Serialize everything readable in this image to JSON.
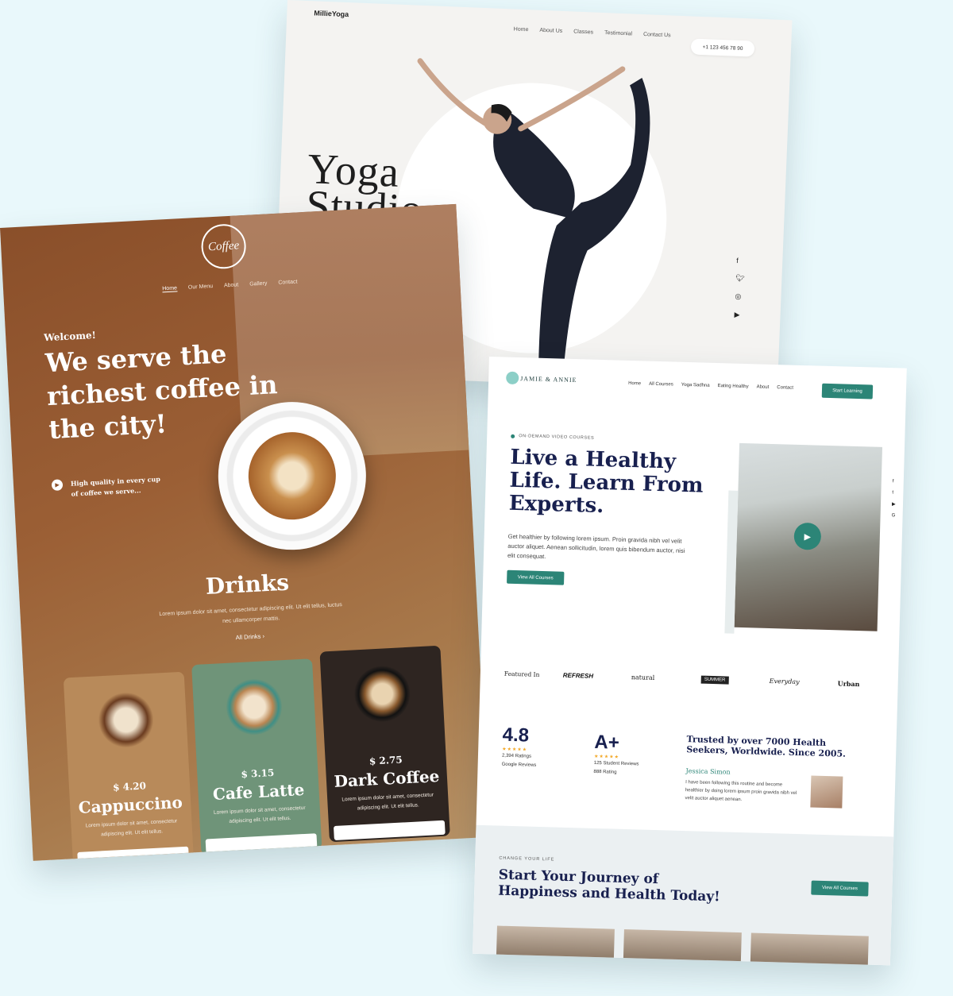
{
  "yoga": {
    "brand": "MillieYoga",
    "nav": [
      "Home",
      "About Us",
      "Classes",
      "Testimonial",
      "Contact Us"
    ],
    "phone": "+1 123 456 78 90",
    "title_line1": "Yoga",
    "title_line2": "Studio",
    "social_icons": [
      "facebook-icon",
      "twitter-icon",
      "instagram-icon",
      "youtube-icon"
    ]
  },
  "coffee": {
    "logo": "Coffee",
    "nav": [
      "Home",
      "Our Menu",
      "About",
      "Gallery",
      "Contact"
    ],
    "welcome": "Welcome!",
    "headline": "We serve the richest coffee in the city!",
    "play_text": "High quality in every cup of coffee we serve...",
    "drinks_title": "Drinks",
    "drinks_desc": "Lorem ipsum dolor sit amet, consectetur adipiscing elit. Ut elit tellus, luctus nec ullamcorper mattis.",
    "all_drinks": "All Drinks",
    "cards": [
      {
        "price": "$ 4.20",
        "name": "Cappuccino",
        "desc": "Lorem ipsum dolor sit amet, consectetur adipiscing elit. Ut elit tellus.",
        "bg": "#b88a5a"
      },
      {
        "price": "$ 3.15",
        "name": "Cafe Latte",
        "desc": "Lorem ipsum dolor sit amet, consectetur adipiscing elit. Ut elit tellus.",
        "bg": "#6f9479"
      },
      {
        "price": "$ 2.75",
        "name": "Dark Coffee",
        "desc": "Lorem ipsum dolor sit amet, consectetur adipiscing elit. Ut elit tellus.",
        "bg": "#2e2521"
      }
    ]
  },
  "health": {
    "logo": "JAMIE & ANNIE",
    "nav": [
      "Home",
      "All Courses",
      "Yoga Sadhna",
      "Eating Healthy",
      "About",
      "Contact"
    ],
    "start_button": "Start Learning",
    "eyebrow": "ON-DEMAND VIDEO COURSES",
    "hero": "Live a Healthy Life. Learn From Experts.",
    "hero_text": "Get healthier by following lorem ipsum. Proin gravida nibh vel velit auctor aliquet. Aenean sollicitudin, lorem quis bibendum auctor, nisi elit consequat.",
    "view_button": "View All Courses",
    "featured_label": "Featured In",
    "featured_logos": [
      "REFRESH",
      "natural",
      "SUMMER",
      "Everyday",
      "Urban"
    ],
    "rating1": {
      "value": "4.8",
      "stars": "★★★★★",
      "line1": "2,394 Ratings",
      "line2": "Google Reviews"
    },
    "rating2": {
      "value": "A+",
      "stars": "★★★★★",
      "line1": "125 Student Reviews",
      "line2": "888 Rating"
    },
    "trust": "Trusted by over 7000 Health Seekers, Worldwide. Since 2005.",
    "testimonial_name": "Jessica Simon",
    "testimonial_text": "I have been following this routine and become healthier by doing lorem ipsum proin gravida nibh vel velit auctor aliquet aenean.",
    "change_label": "CHANGE YOUR LIFE",
    "journey": "Start Your Journey of Happiness and Health Today!",
    "view_all": "View All Courses",
    "accent": "#2c8577"
  }
}
